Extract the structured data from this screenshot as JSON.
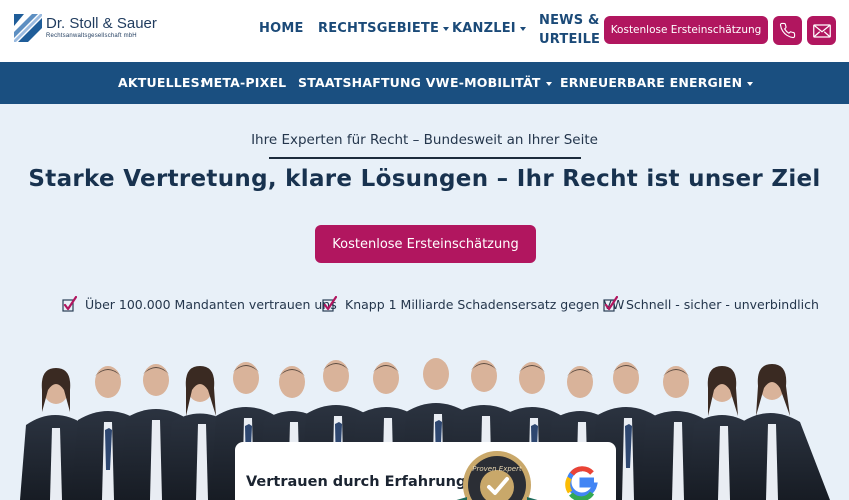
{
  "header": {
    "logo": {
      "name": "Dr. Stoll & Sauer",
      "subtitle": "Rechtsanwaltsgesellschaft mbH"
    },
    "nav": [
      {
        "label": "HOME",
        "has_dropdown": false
      },
      {
        "label": "RECHTSGEBIETE",
        "has_dropdown": true
      },
      {
        "label": "KANZLEI",
        "has_dropdown": true
      },
      {
        "label_line1": "NEWS &",
        "label_line2": "URTEILE",
        "has_dropdown": false
      }
    ],
    "cta_label": "Kostenlose Ersteinschätzung",
    "icons": [
      "phone-icon",
      "mail-icon"
    ]
  },
  "subnav": {
    "prefix": "AKTUELLES:",
    "items": [
      {
        "label": "META-PIXEL",
        "has_dropdown": false
      },
      {
        "label": "STAATSHAFTUNG VW",
        "has_dropdown": false
      },
      {
        "label": "E-MOBILITÄT",
        "has_dropdown": true
      },
      {
        "label": "ERNEUERBARE ENERGIEN",
        "has_dropdown": true
      }
    ]
  },
  "hero": {
    "eyebrow": "Ihre Experten für Recht – Bundesweit an Ihrer Seite",
    "headline": "Starke Vertretung, klare Lösungen – Ihr Recht ist unser Ziel",
    "cta_label": "Kostenlose Ersteinschätzung",
    "features": [
      "Über 100.000 Mandanten vertrauen uns",
      "Knapp 1 Milliarde Schadensersatz gegen VW",
      "Schnell - sicher - unverbindlich"
    ]
  },
  "trust": {
    "label": "Vertrauen durch Erfahrung:",
    "badge_text": "Proven Expert",
    "badges": [
      "proven-expert-badge",
      "google-logo"
    ]
  },
  "colors": {
    "brand_navy": "#1a4f80",
    "accent_magenta": "#b1165f",
    "page_bg": "#e8f0f8"
  }
}
